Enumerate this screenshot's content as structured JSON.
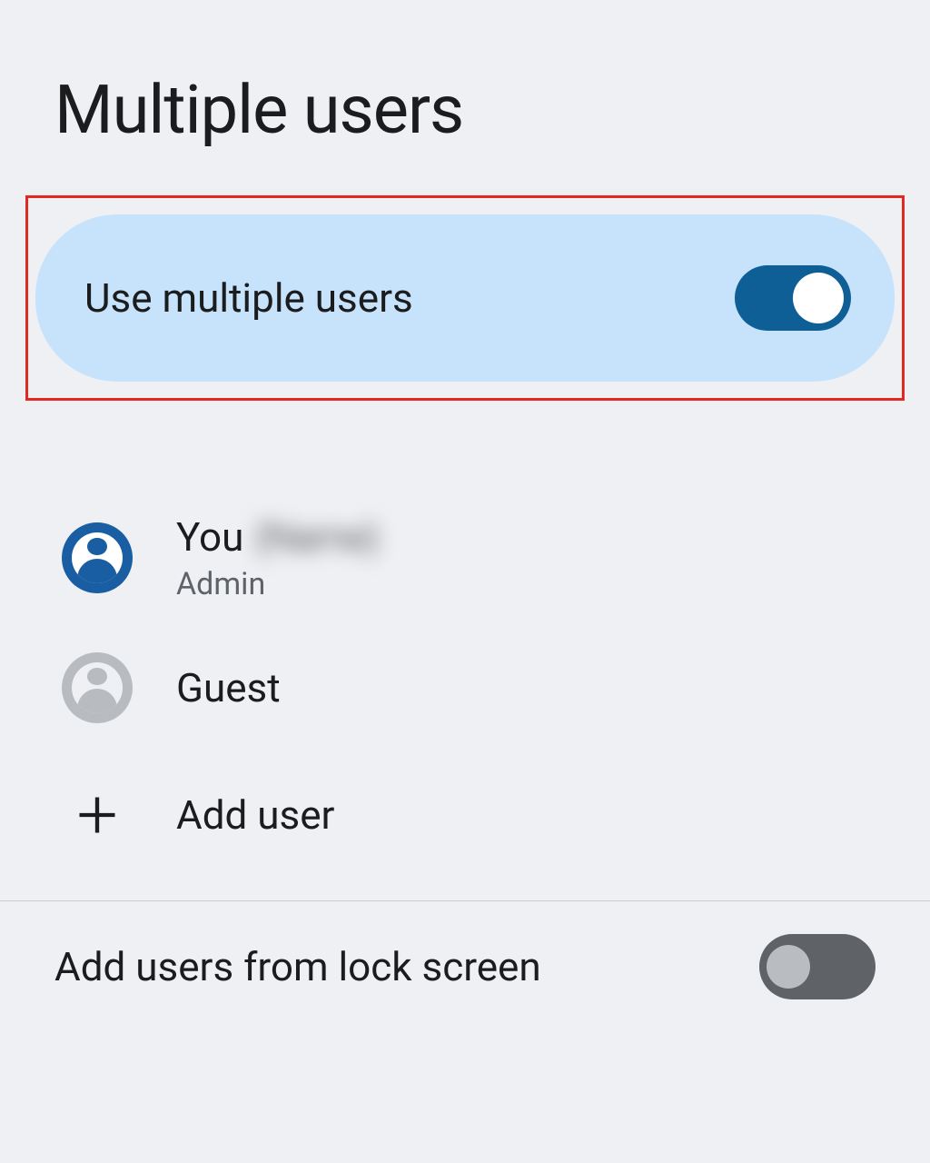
{
  "header": {
    "title": "Multiple users"
  },
  "toggleSection": {
    "label": "Use multiple users",
    "state": "on"
  },
  "users": {
    "you": {
      "primary": "You",
      "redacted": "(Name)",
      "secondary": "Admin"
    },
    "guest": {
      "primary": "Guest"
    },
    "addUser": {
      "label": "Add user"
    }
  },
  "lockScreen": {
    "label": "Add users from lock screen",
    "state": "off"
  }
}
